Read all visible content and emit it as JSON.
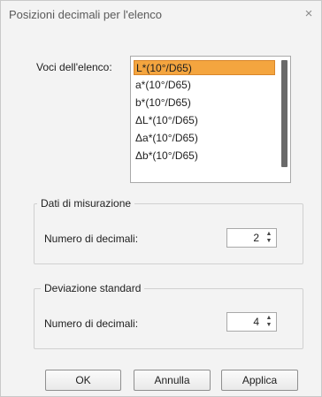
{
  "window": {
    "title": "Posizioni decimali per l'elenco",
    "close_glyph": "×"
  },
  "list": {
    "label": "Voci dell'elenco:",
    "items": [
      "L*(10°/D65)",
      "a*(10°/D65)",
      "b*(10°/D65)",
      "ΔL*(10°/D65)",
      "Δa*(10°/D65)",
      "Δb*(10°/D65)"
    ],
    "selected_index": 0,
    "selected_color": "#f4a53f"
  },
  "measurement": {
    "legend": "Dati di misurazione",
    "decimals_label": "Numero di decimali:",
    "decimals_value": "2"
  },
  "deviation": {
    "legend": "Deviazione standard",
    "decimals_label": "Numero di decimali:",
    "decimals_value": "4"
  },
  "buttons": {
    "ok": "OK",
    "cancel": "Annulla",
    "apply": "Applica"
  },
  "spin_glyphs": {
    "up": "▲",
    "down": "▼"
  }
}
